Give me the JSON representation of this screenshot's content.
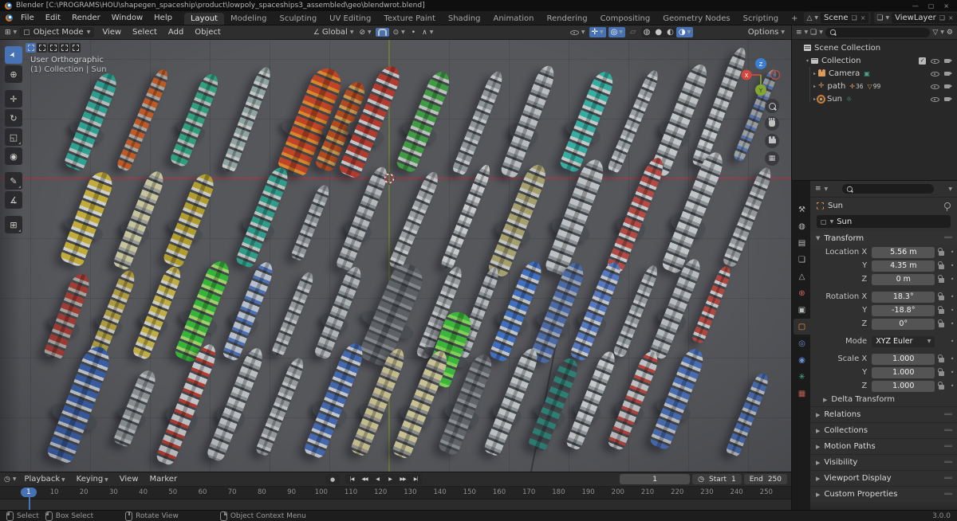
{
  "titlebar": {
    "title": "Blender [C:\\PROGRAMS\\HOU\\shapegen_spaceship\\product\\lowpoly_spaceships3_assembled\\geo\\blendwrot.blend]",
    "window_buttons": [
      {
        "name": "minimize",
        "glyph": "—"
      },
      {
        "name": "maximize",
        "glyph": "▢"
      },
      {
        "name": "close",
        "glyph": "×"
      }
    ]
  },
  "topbar": {
    "menus": [
      "File",
      "Edit",
      "Render",
      "Window",
      "Help"
    ],
    "workspaces": [
      "Layout",
      "Modeling",
      "Sculpting",
      "UV Editing",
      "Texture Paint",
      "Shading",
      "Animation",
      "Rendering",
      "Compositing",
      "Geometry Nodes",
      "Scripting"
    ],
    "active_workspace": "Layout",
    "add_workspace": "+",
    "scene_selector": {
      "icon": "△",
      "value": "Scene",
      "copy_glyph": "❏",
      "close_glyph": "×"
    },
    "viewlayer_selector": {
      "icon": "❏",
      "value": "ViewLayer",
      "copy_glyph": "❏",
      "close_glyph": "×"
    }
  },
  "viewport_header": {
    "editor_icon": "⊞",
    "mode_icon": "▢",
    "mode": "Object Mode",
    "menus": [
      "View",
      "Select",
      "Add",
      "Object"
    ],
    "orientation_icon": "∠",
    "orientation": "Global",
    "snap_icon": "⊘",
    "snap_target_icon": "⊙",
    "prop_edit_icon": "•",
    "falloff_icon": "∧",
    "visibility_icon": "eye",
    "gizmo_icon": "✛",
    "overlays_icon": "◎",
    "xray_icon": "▱",
    "shading": [
      {
        "name": "wireframe",
        "glyph": "◍",
        "active": false
      },
      {
        "name": "solid",
        "glyph": "●",
        "active": false
      },
      {
        "name": "material-preview",
        "glyph": "◐",
        "active": false
      },
      {
        "name": "rendered",
        "glyph": "◑",
        "active": true
      }
    ],
    "options_label": "Options"
  },
  "toolbar": {
    "tools": [
      {
        "name": "select-box",
        "glyph": "➤",
        "active": true,
        "corner": false
      },
      {
        "name": "cursor",
        "glyph": "⊕",
        "corner": false
      },
      {
        "name": "move",
        "glyph": "✛",
        "corner": false
      },
      {
        "name": "rotate",
        "glyph": "↻",
        "corner": false
      },
      {
        "name": "scale",
        "glyph": "◱",
        "corner": true
      },
      {
        "name": "transform",
        "glyph": "◉",
        "corner": false
      },
      {
        "name": "annotate",
        "glyph": "✎",
        "corner": true
      },
      {
        "name": "measure",
        "glyph": "∡",
        "corner": false
      },
      {
        "name": "add-cube",
        "glyph": "⊞",
        "corner": true
      }
    ],
    "select_modes": [
      "new",
      "extend",
      "subtract",
      "invert",
      "intersect"
    ]
  },
  "viewport": {
    "overlay": {
      "line1": "User Orthographic",
      "line2": "(1) Collection | Sun"
    },
    "gizmo": {
      "x_label": "X",
      "y_label": "Y",
      "z_label": "Z",
      "x_color": "#d4473d",
      "y_color": "#83a832",
      "z_color": "#3b7fd4"
    },
    "nav_buttons": [
      "zoom",
      "pan",
      "camera-view",
      "grid-ortho"
    ],
    "axis_colors": {
      "x_line": "#a83a46",
      "y_line": "#748036"
    },
    "ships": [
      [
        115,
        102,
        128,
        26,
        22,
        "#2ea393",
        "#b9c0bf"
      ],
      [
        180,
        100,
        136,
        18,
        23,
        "#bf5a26",
        "#a9a5a0"
      ],
      [
        245,
        100,
        122,
        22,
        22,
        "#2f9f7d",
        "#b4bab6"
      ],
      [
        310,
        100,
        140,
        18,
        21,
        "#8fa3a0",
        "#c4c9c6"
      ],
      [
        390,
        102,
        140,
        38,
        22,
        "#bf4526",
        "#d8872e"
      ],
      [
        428,
        108,
        118,
        24,
        23,
        "#b24a20",
        "#c59a55"
      ],
      [
        465,
        102,
        148,
        28,
        23,
        "#b23b30",
        "#c3c6c8"
      ],
      [
        532,
        102,
        132,
        26,
        22,
        "#3f9c43",
        "#bcc2bd"
      ],
      [
        600,
        104,
        138,
        18,
        22,
        "#90959a",
        "#c2c6c9"
      ],
      [
        663,
        102,
        148,
        22,
        21,
        "#b9bdc0",
        "#888d92"
      ],
      [
        737,
        102,
        132,
        26,
        22,
        "#35ada0",
        "#c5cac8"
      ],
      [
        795,
        102,
        138,
        16,
        23,
        "#9aa0a4",
        "#c6cacc"
      ],
      [
        853,
        100,
        148,
        24,
        22,
        "#c3c6c8",
        "#8f9498"
      ],
      [
        903,
        84,
        158,
        18,
        21,
        "#c8cbcd",
        "#94999d"
      ],
      [
        948,
        94,
        122,
        14,
        22,
        "#9fa6ab",
        "#5a79b5"
      ],
      [
        110,
        224,
        122,
        30,
        21,
        "#c2ab38",
        "#ccd0cf"
      ],
      [
        175,
        226,
        130,
        22,
        22,
        "#c5c49c",
        "#9a9d98"
      ],
      [
        238,
        226,
        122,
        26,
        22,
        "#b09d2e",
        "#c9c9c2"
      ],
      [
        330,
        222,
        132,
        24,
        22,
        "#2f9c8a",
        "#bcc4c0"
      ],
      [
        390,
        229,
        100,
        16,
        22,
        "#8f9498",
        "#b9bdc0"
      ],
      [
        455,
        224,
        138,
        20,
        22,
        "#b4b7ba",
        "#84898d"
      ],
      [
        520,
        226,
        130,
        18,
        23,
        "#9b9ea1",
        "#c4c7ca"
      ],
      [
        585,
        222,
        140,
        16,
        22,
        "#c7c9cb",
        "#93989c"
      ],
      [
        650,
        226,
        148,
        26,
        22,
        "#a59f6e",
        "#c2c5c0"
      ],
      [
        722,
        222,
        152,
        28,
        21,
        "#bec1c3",
        "#8c9196"
      ],
      [
        798,
        219,
        152,
        22,
        22,
        "#b34a44",
        "#c8cbcd"
      ],
      [
        870,
        216,
        160,
        26,
        22,
        "#c2c5c7",
        "#8d9297"
      ],
      [
        938,
        222,
        132,
        18,
        22,
        "#979a9d",
        "#c2c5c8"
      ],
      [
        85,
        347,
        112,
        24,
        21,
        "#a03c34",
        "#a8a39f"
      ],
      [
        142,
        344,
        116,
        20,
        22,
        "#ac9a3e",
        "#c6c3b8"
      ],
      [
        198,
        342,
        122,
        22,
        22,
        "#bfad45",
        "#ccccc5"
      ],
      [
        255,
        340,
        132,
        28,
        22,
        "#36b339",
        "#9fd06a"
      ],
      [
        312,
        340,
        130,
        22,
        22,
        "#b7bfca",
        "#4a6fb5"
      ],
      [
        368,
        344,
        112,
        16,
        22,
        "#94989b",
        "#bdc0c3"
      ],
      [
        425,
        342,
        122,
        20,
        22,
        "#b1b4b7",
        "#868b90"
      ],
      [
        492,
        344,
        132,
        40,
        23,
        "#5d6165",
        "#83878b"
      ],
      [
        552,
        342,
        122,
        18,
        22,
        "#999da0",
        "#c2c5c8"
      ],
      [
        600,
        342,
        120,
        16,
        21,
        "#b5b8bb",
        "#8b9094"
      ],
      [
        648,
        340,
        132,
        24,
        22,
        "#3e6fc0",
        "#c3c6c9"
      ],
      [
        700,
        342,
        132,
        26,
        22,
        "#4a69a6",
        "#9aa4b4"
      ],
      [
        748,
        340,
        130,
        22,
        22,
        "#5578c0",
        "#c5c8ca"
      ],
      [
        798,
        340,
        122,
        16,
        22,
        "#94999d",
        "#c0c3c6"
      ],
      [
        848,
        337,
        132,
        22,
        22,
        "#b8bbbe",
        "#878c91"
      ],
      [
        893,
        332,
        102,
        16,
        22,
        "#b04840",
        "#c6c9cb"
      ],
      [
        563,
        388,
        96,
        34,
        20,
        "#3bb53b",
        "#7ed058"
      ],
      [
        100,
        457,
        152,
        34,
        21,
        "#3a5fa8",
        "#c2c7cc"
      ],
      [
        170,
        462,
        100,
        22,
        22,
        "#8f9396",
        "#b8bcbf"
      ],
      [
        235,
        457,
        160,
        24,
        22,
        "#c3c6c8",
        "#b23b30"
      ],
      [
        296,
        457,
        150,
        22,
        22,
        "#bbbec1",
        "#8b9094"
      ],
      [
        352,
        460,
        130,
        18,
        22,
        "#95999c",
        "#bfc2c5"
      ],
      [
        420,
        452,
        152,
        26,
        22,
        "#4468b0",
        "#c3c7cb"
      ],
      [
        475,
        454,
        142,
        22,
        22,
        "#c2bc8d",
        "#96918a"
      ],
      [
        528,
        457,
        142,
        24,
        22,
        "#c7c194",
        "#8a8d89"
      ],
      [
        585,
        457,
        132,
        26,
        22,
        "#616468",
        "#8a8e92"
      ],
      [
        642,
        454,
        142,
        22,
        22,
        "#bec1c4",
        "#8d9296"
      ],
      [
        695,
        457,
        122,
        24,
        22,
        "#2e7e73",
        "#3c4448"
      ],
      [
        742,
        452,
        130,
        20,
        22,
        "#c5c8ca",
        "#92979b"
      ],
      [
        795,
        452,
        130,
        22,
        22,
        "#bfc2c4",
        "#b2433d"
      ],
      [
        850,
        450,
        132,
        26,
        22,
        "#4a70b8",
        "#c4c7ca"
      ],
      [
        938,
        470,
        110,
        18,
        22,
        "#4a70b8",
        "#c5c8ca"
      ]
    ]
  },
  "outliner": {
    "editor_icon": "≡",
    "funnel_icon": "▽",
    "filter_icon": "⚙",
    "search_placeholder": "",
    "rows": [
      {
        "label": "Scene Collection",
        "icon": "scene-collection",
        "indent": 0
      },
      {
        "label": "Collection",
        "icon": "collection",
        "indent": 1,
        "caret": "▾",
        "checkbox": "✓",
        "eye": true,
        "cam": true
      },
      {
        "label": "Camera",
        "icon": "camera",
        "indent": 2,
        "caret": "▸",
        "extras": [
          {
            "name": "camera-data",
            "glyph": "▣",
            "color": "#4aa58c",
            "count": ""
          }
        ],
        "eye": true,
        "cam": true
      },
      {
        "label": "path",
        "icon": "empty-axes",
        "indent": 2,
        "caret": "▸",
        "extras": [
          {
            "name": "empty-data",
            "glyph": "✛",
            "color": "#d99a5b",
            "count": "36"
          },
          {
            "name": "mesh-data",
            "glyph": "▽",
            "color": "#d99a5b",
            "count": "99"
          }
        ],
        "eye": true,
        "cam": true
      },
      {
        "label": "Sun",
        "icon": "sun-light",
        "indent": 2,
        "caret": "▸",
        "selected": true,
        "extras": [
          {
            "name": "sun-data",
            "glyph": "☼",
            "color": "#4aa58c",
            "count": ""
          }
        ],
        "eye": true,
        "cam": true
      }
    ]
  },
  "properties": {
    "editor_icon": "≡",
    "tabs": [
      {
        "name": "tool",
        "glyph": "⚒",
        "color": "#b9bcbe",
        "active": false
      },
      {
        "name": "render",
        "glyph": "◍",
        "color": "#b9bcbe",
        "active": false
      },
      {
        "name": "output",
        "glyph": "▤",
        "color": "#b9bcbe",
        "active": false
      },
      {
        "name": "view-layer",
        "glyph": "❏",
        "color": "#b9bcbe",
        "active": false
      },
      {
        "name": "scene",
        "glyph": "△",
        "color": "#b9bcbe",
        "active": false
      },
      {
        "name": "world",
        "glyph": "⊕",
        "color": "#cf6a55",
        "active": false
      },
      {
        "name": "collection",
        "glyph": "▣",
        "color": "#b9bcbe",
        "active": false
      },
      {
        "name": "object",
        "glyph": "▢",
        "color": "#e8933f",
        "active": true
      },
      {
        "name": "physics",
        "glyph": "◎",
        "color": "#6b8fd6",
        "active": false
      },
      {
        "name": "constraints",
        "glyph": "◉",
        "color": "#6b8fd6",
        "active": false
      },
      {
        "name": "object-data",
        "glyph": "✳",
        "color": "#49b08a",
        "active": false
      },
      {
        "name": "texture",
        "glyph": "▦",
        "color": "#c25b50",
        "active": false
      }
    ],
    "breadcrumb": "Sun",
    "object_name": "Sun",
    "transform": {
      "title": "Transform",
      "rows": [
        {
          "label": "Location X",
          "value": "5.56 m",
          "lock": true,
          "group_end": false
        },
        {
          "label": "Y",
          "value": "4.35 m",
          "lock": true,
          "group_end": false
        },
        {
          "label": "Z",
          "value": "0 m",
          "lock": true,
          "group_end": true
        },
        {
          "label": "Rotation X",
          "value": "18.3°",
          "lock": true,
          "group_end": false
        },
        {
          "label": "Y",
          "value": "-18.8°",
          "lock": true,
          "group_end": false
        },
        {
          "label": "Z",
          "value": "0°",
          "lock": true,
          "group_end": true
        },
        {
          "label": "Mode",
          "value": "XYZ Euler",
          "dropdown": true,
          "group_end": true
        },
        {
          "label": "Scale X",
          "value": "1.000",
          "lock": true,
          "group_end": false
        },
        {
          "label": "Y",
          "value": "1.000",
          "lock": true,
          "group_end": false
        },
        {
          "label": "Z",
          "value": "1.000",
          "lock": true,
          "group_end": false
        }
      ],
      "subpanel": "Delta Transform"
    },
    "panels": [
      "Relations",
      "Collections",
      "Motion Paths",
      "Visibility",
      "Viewport Display",
      "Custom Properties"
    ]
  },
  "timeline": {
    "editor_icon": "◷",
    "menus": [
      {
        "label": "Playback",
        "caret": true
      },
      {
        "label": "Keying",
        "caret": true
      },
      {
        "label": "View",
        "caret": false
      },
      {
        "label": "Marker",
        "caret": false
      }
    ],
    "record_glyph": "●",
    "transport": [
      {
        "name": "jump-start",
        "glyph": "|◀"
      },
      {
        "name": "prev-keyframe",
        "glyph": "◀◀"
      },
      {
        "name": "play-reverse",
        "glyph": "◀"
      },
      {
        "name": "play",
        "glyph": "▶"
      },
      {
        "name": "next-keyframe",
        "glyph": "▶▶"
      },
      {
        "name": "jump-end",
        "glyph": "▶|"
      }
    ],
    "current_frame": "1",
    "clock_icon": "◷",
    "start_label": "Start",
    "start_value": "1",
    "end_label": "End",
    "end_value": "250",
    "ticks": [
      10,
      20,
      30,
      40,
      50,
      60,
      70,
      80,
      90,
      100,
      110,
      120,
      130,
      140,
      150,
      160,
      170,
      180,
      190,
      200,
      210,
      220,
      230,
      240,
      250
    ],
    "badge_frame": "1"
  },
  "statusbar": {
    "hints": [
      {
        "icon": "mouse-left",
        "label": "Select"
      },
      {
        "icon": "mouse-left",
        "label": "Box Select"
      },
      {
        "icon": "mouse-middle",
        "label": "Rotate View"
      },
      {
        "icon": "mouse-right",
        "label": "Object Context Menu"
      }
    ],
    "version": "3.0.0"
  }
}
